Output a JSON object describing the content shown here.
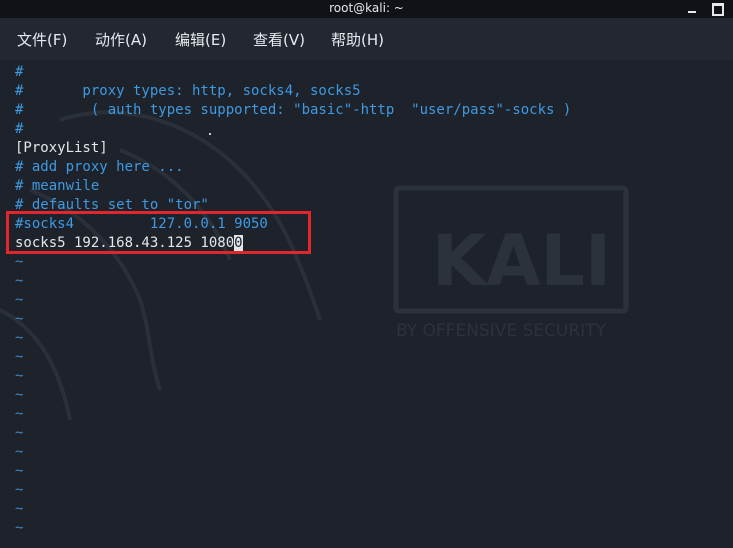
{
  "window": {
    "title": "root@kali: ~"
  },
  "menubar": {
    "items": [
      {
        "label": "文件(F)"
      },
      {
        "label": "动作(A)"
      },
      {
        "label": "编辑(E)"
      },
      {
        "label": "查看(V)"
      },
      {
        "label": "帮助(H)"
      }
    ]
  },
  "watermark": {
    "logo_text": "KALI",
    "tagline": "BY OFFENSIVE SECURITY"
  },
  "editor": {
    "lines": [
      "#",
      "#       proxy types: http, socks4, socks5",
      "#        ( auth types supported: \"basic\"-http  \"user/pass\"-socks )",
      "#",
      "[ProxyList]",
      "# add proxy here ...",
      "# meanwile",
      "# defaults set to \"tor\"",
      "#socks4         127.0.0.1 9050"
    ],
    "active_line_text": "socks5 192.168.43.125 1080",
    "cursor_char": "0",
    "empty_marker": "~"
  },
  "colors": {
    "comment": "#3d9ae3",
    "text": "#e4e6ea",
    "background": "#1e222a",
    "highlight_box": "#e3262e"
  }
}
